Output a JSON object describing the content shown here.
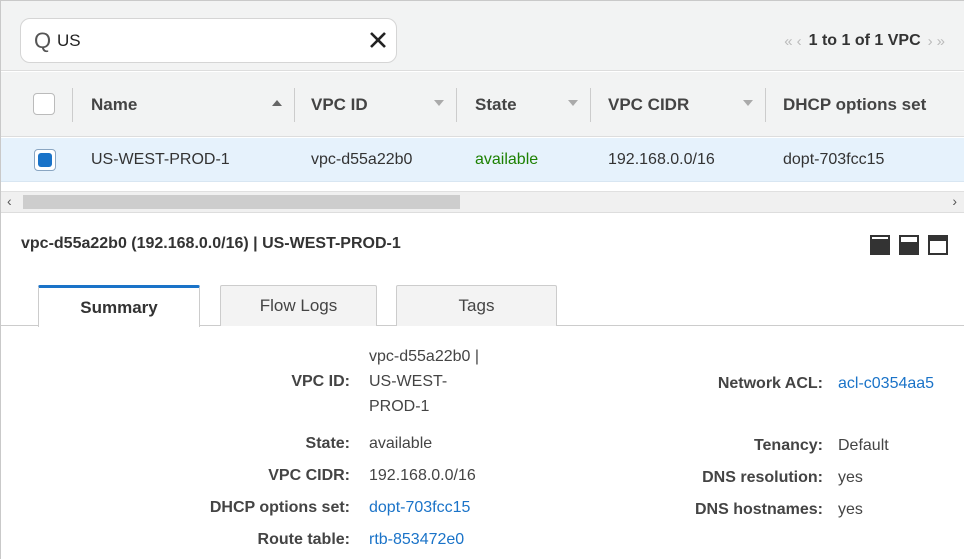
{
  "search": {
    "icon_glyph": "Q",
    "value": "US"
  },
  "pager": {
    "first_glyph": "«",
    "prev_glyph": "‹",
    "text": "1 to 1 of 1 VPC",
    "next_glyph": "›",
    "last_glyph": "»"
  },
  "table": {
    "columns": [
      "Name",
      "VPC ID",
      "State",
      "VPC CIDR",
      "DHCP options set"
    ],
    "rows": [
      {
        "name": "US-WEST-PROD-1",
        "vpc_id": "vpc-d55a22b0",
        "state": "available",
        "vpc_cidr": "192.168.0.0/16",
        "dhcp": "dopt-703fcc15"
      }
    ]
  },
  "scrollbar": {
    "left_glyph": "‹",
    "right_glyph": "›"
  },
  "detail": {
    "title": "vpc-d55a22b0 (192.168.0.0/16) | US-WEST-PROD-1"
  },
  "tabs": [
    "Summary",
    "Flow Logs",
    "Tags"
  ],
  "summary": {
    "left": [
      {
        "label": "VPC ID:",
        "value_lines": [
          "vpc-d55a22b0 |",
          "US-WEST-",
          "PROD-1"
        ]
      },
      {
        "label": "State:",
        "value": "available"
      },
      {
        "label": "VPC CIDR:",
        "value": "192.168.0.0/16"
      },
      {
        "label": "DHCP options set:",
        "value": "dopt-703fcc15"
      },
      {
        "label": "Route table:",
        "value": "rtb-853472e0"
      }
    ],
    "right": [
      {
        "label": "Network ACL:",
        "value": "acl-c0354aa5"
      },
      {
        "label": "Tenancy:",
        "value": "Default"
      },
      {
        "label": "DNS resolution:",
        "value": "yes"
      },
      {
        "label": "DNS hostnames:",
        "value": "yes"
      }
    ]
  },
  "colors": {
    "accent": "#1a73c8",
    "available": "#1d8102",
    "selected_row": "#e6f2fc"
  }
}
